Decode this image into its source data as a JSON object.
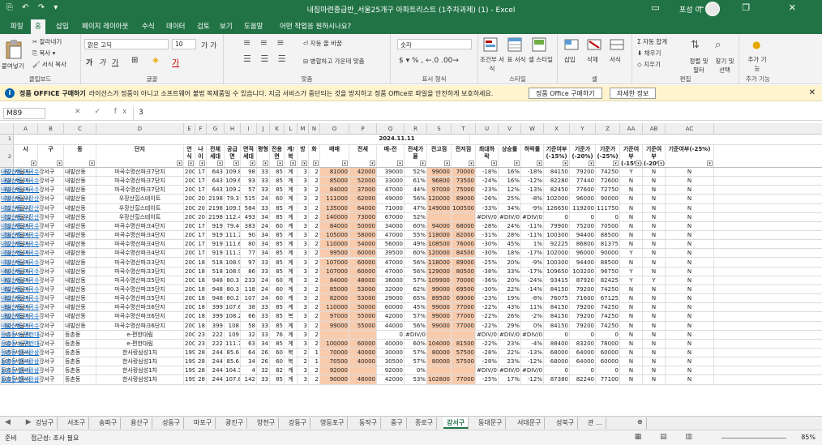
{
  "title": {
    "quick_access": "⎘ ↶ ↷ ▾",
    "doc": "내집마련종급반_서울25개구 아파트리스트 (1주차과제) (1) - Excel",
    "user": "포성 이",
    "avatar": "◯",
    "win": "▭ ─ ❐ ✕"
  },
  "tabs": [
    "파일",
    "홈",
    "삽입",
    "페이지 레이아웃",
    "수식",
    "데이터",
    "검토",
    "보기",
    "도움말",
    "어떤 작업을 원하시나요?"
  ],
  "ribbon": {
    "clipboard": {
      "paste": "붙여넣기",
      "cut": "잘라내기",
      "copy": "복사 ▾",
      "format": "서식 복사",
      "label": "클립보드"
    },
    "font": {
      "name": "맑은 고딕",
      "size": "10",
      "bold": "가",
      "italic": "가",
      "under": "가",
      "label": "글꼴",
      "grow": "가 가"
    },
    "align": {
      "wrap": "자동 줄 바꿈",
      "merge": "병합하고 가운데 맞춤",
      "label": "맞춤"
    },
    "number": {
      "format": "숫자",
      "pct": "% ,",
      "label": "표시 형식"
    },
    "styles": {
      "cond": "조건부 서식",
      "table": "표 서식",
      "cell": "셀 스타일",
      "label": "스타일"
    },
    "cells": {
      "insert": "삽입",
      "delete": "삭제",
      "format": "서식",
      "label": "셀"
    },
    "edit": {
      "sum": "자동 합계",
      "fill": "채우기",
      "clear": "지우기",
      "sort": "정렬 및 필터",
      "find": "찾기 및 선택",
      "label": "편집"
    },
    "addin": {
      "btn": "추가 기능",
      "label": "추가 기능"
    }
  },
  "message": {
    "bold": "정품 OFFICE 구매하기",
    "text": "라이선스가 정품이 아니고 소프트웨어 불법 복제품일 수 있습니다. 지금 서비스가 중단되는 것을 방지하고 정품 Office로 파일을 안전하게 보호하세요.",
    "btn1": "정품 Office 구매하기",
    "btn2": "자세한 정보",
    "close": "✕"
  },
  "formula": {
    "cell": "M89",
    "fx": "✕ ✓ fx",
    "value": "3"
  },
  "columns": [
    "A",
    "B",
    "C",
    "D",
    "E",
    "F",
    "G",
    "H",
    "I",
    "J",
    "K",
    "L",
    "M",
    "N",
    "O",
    "P",
    "Q",
    "R",
    "S",
    "T",
    "U",
    "V",
    "W",
    "X",
    "Y",
    "Z",
    "AA",
    "AB",
    "AC"
  ],
  "date": "2024.11.11",
  "headers": [
    "시",
    "구",
    "동",
    "단지",
    "연식",
    "나이",
    "전체세대",
    "공급면",
    "면적세대",
    "평형",
    "전용면",
    "계/복",
    "방",
    "화",
    "매매",
    "전세",
    "매-전",
    "전세가율",
    "전고점",
    "전저점",
    "최대하락",
    "상승률",
    "하락률",
    "기준여부(-15%)",
    "기준가(-20%)",
    "기준가(-25%)",
    "기준여부(-15%)",
    "기준여부(-20%)",
    "기준여부(-25%)"
  ],
  "rows": [
    {
      "n": "67",
      "d": [
        "서울시",
        "강서구",
        "내발산동",
        "마곡수명산파크7단지",
        "2008",
        "17",
        "643",
        "109.8",
        "98",
        "33",
        "85",
        "계",
        "3",
        "2",
        "81000",
        "42000",
        "39000",
        "52%",
        "99000",
        "70000",
        "-18%",
        "16%",
        "-18%",
        "84150",
        "79200",
        "74250",
        "Y",
        "N",
        "N",
        "내발산동 마곡수"
      ]
    },
    {
      "n": "68",
      "d": [
        "서울시",
        "강서구",
        "내발산동",
        "마곡수명산파크7단지",
        "2008",
        "17",
        "643",
        "109.6",
        "93",
        "33",
        "85",
        "계",
        "3",
        "2",
        "85000",
        "52000",
        "33000",
        "61%",
        "96800",
        "73500",
        "-24%",
        "16%",
        "-12%",
        "82280",
        "77440",
        "72600",
        "N",
        "N",
        "N",
        "내발산동 마곡수"
      ]
    },
    {
      "n": "69",
      "d": [
        "서울시",
        "강서구",
        "내발산동",
        "마곡수명산파크7단지",
        "2008",
        "17",
        "643",
        "109.2",
        "57",
        "33",
        "85",
        "계",
        "3",
        "2",
        "84000",
        "37000",
        "47000",
        "44%",
        "97000",
        "75000",
        "-23%",
        "12%",
        "-13%",
        "82450",
        "77600",
        "72750",
        "N",
        "N",
        "N",
        "내발산동 마곡수"
      ]
    },
    {
      "n": "70",
      "d": [
        "서울시",
        "강서구",
        "내발산동",
        "우장산힐스테이트",
        "2005",
        "20",
        "2198",
        "79.3",
        "515",
        "24",
        "60",
        "계",
        "3",
        "2",
        "111000",
        "62000",
        "49000",
        "56%",
        "120000",
        "89000",
        "-26%",
        "25%",
        "-8%",
        "102000",
        "96000",
        "90000",
        "N",
        "N",
        "N",
        "내발산동 우장산"
      ]
    },
    {
      "n": "71",
      "d": [
        "서울시",
        "강서구",
        "내발산동",
        "우장산힐스테이트",
        "2005",
        "20",
        "2198",
        "109.1",
        "584",
        "33",
        "85",
        "계",
        "3",
        "2",
        "135000",
        "64000",
        "71000",
        "47%",
        "149000",
        "100500",
        "-33%",
        "34%",
        "-9%",
        "126650",
        "119200",
        "111750",
        "N",
        "N",
        "N",
        "내발산동 우장산"
      ]
    },
    {
      "n": "72",
      "d": [
        "서울시",
        "강서구",
        "내발산동",
        "우장산힐스테이트",
        "2005",
        "20",
        "2198",
        "112.4",
        "493",
        "34",
        "85",
        "계",
        "3",
        "2",
        "140000",
        "73000",
        "67000",
        "52%",
        "",
        "",
        "#DIV/0!",
        "#DIV/0!",
        "#DIV/0!",
        "0",
        "0",
        "0",
        "N",
        "N",
        "N",
        "내발산동 우장산"
      ]
    },
    {
      "n": "75",
      "d": [
        "서울시",
        "강서구",
        "내발산동",
        "마곡수명산파크4단지",
        "2008",
        "17",
        "919",
        "79.4",
        "383",
        "24",
        "60",
        "계",
        "3",
        "2",
        "84000",
        "50000",
        "34000",
        "60%",
        "94000",
        "68000",
        "-28%",
        "24%",
        "-11%",
        "79900",
        "75200",
        "70500",
        "N",
        "N",
        "N",
        "내발산동 마곡수"
      ]
    },
    {
      "n": "76",
      "d": [
        "서울시",
        "강서구",
        "내발산동",
        "마곡수명산파크4단지",
        "2008",
        "17",
        "919",
        "111.7",
        "90",
        "34",
        "85",
        "계",
        "3",
        "2",
        "105000",
        "58000",
        "47000",
        "55%",
        "118000",
        "82000",
        "-31%",
        "28%",
        "-11%",
        "100300",
        "94400",
        "88500",
        "N",
        "N",
        "N",
        "내발산동 마곡수"
      ]
    },
    {
      "n": "77",
      "d": [
        "서울시",
        "강서구",
        "내발산동",
        "마곡수명산파크4단지",
        "2008",
        "17",
        "919",
        "111.6",
        "80",
        "34",
        "85",
        "계",
        "3",
        "2",
        "110000",
        "54000",
        "56000",
        "49%",
        "108500",
        "76000",
        "-30%",
        "45%",
        "1%",
        "92225",
        "86800",
        "81375",
        "N",
        "N",
        "N",
        "내발산동 마곡수"
      ]
    },
    {
      "n": "78",
      "d": [
        "서울시",
        "강서구",
        "내발산동",
        "마곡수명산파크4단지",
        "2008",
        "17",
        "919",
        "111.3",
        "77",
        "34",
        "85",
        "계",
        "3",
        "2",
        "99500",
        "60000",
        "39500",
        "60%",
        "120000",
        "84500",
        "-30%",
        "18%",
        "-17%",
        "102000",
        "96000",
        "90000",
        "Y",
        "N",
        "N",
        "내발산동 마곡수"
      ]
    },
    {
      "n": "79",
      "d": [
        "서울시",
        "강서구",
        "내발산동",
        "마곡수명산파크3단지",
        "2007",
        "18",
        "518",
        "108.9",
        "97",
        "33",
        "85",
        "계",
        "3",
        "2",
        "107000",
        "60000",
        "47000",
        "56%",
        "118000",
        "89000",
        "-25%",
        "20%",
        "-9%",
        "100300",
        "94400",
        "88500",
        "N",
        "N",
        "N",
        "내발산동 마곡수"
      ]
    },
    {
      "n": "80",
      "d": [
        "서울시",
        "강서구",
        "내발산동",
        "마곡수명산파크3단지",
        "2007",
        "18",
        "518",
        "108.9",
        "86",
        "33",
        "85",
        "계",
        "3",
        "2",
        "107000",
        "60000",
        "47000",
        "56%",
        "129000",
        "80500",
        "-38%",
        "33%",
        "-17%",
        "109650",
        "103200",
        "96750",
        "Y",
        "N",
        "N",
        "내발산동 마곡수"
      ]
    },
    {
      "n": "81",
      "d": [
        "서울시",
        "강서구",
        "내발산동",
        "마곡수명산파크5단지",
        "2007",
        "18",
        "948",
        "80.3",
        "233",
        "24",
        "60",
        "계",
        "3",
        "2",
        "84000",
        "48000",
        "36000",
        "57%",
        "109900",
        "70000",
        "-36%",
        "20%",
        "-24%",
        "93415",
        "87920",
        "82425",
        "Y",
        "Y",
        "N",
        "내발산동 마곡수"
      ]
    },
    {
      "n": "82",
      "d": [
        "서울시",
        "강서구",
        "내발산동",
        "마곡수명산파크5단지",
        "2007",
        "18",
        "948",
        "80.3",
        "118",
        "24",
        "60",
        "계",
        "3",
        "2",
        "85000",
        "53000",
        "32000",
        "62%",
        "99000",
        "69500",
        "-30%",
        "22%",
        "-14%",
        "84150",
        "79200",
        "74250",
        "N",
        "N",
        "N",
        "내발산동 마곡수"
      ]
    },
    {
      "n": "83",
      "d": [
        "서울시",
        "강서구",
        "내발산동",
        "마곡수명산파크5단지",
        "2007",
        "18",
        "948",
        "80.2",
        "107",
        "24",
        "60",
        "계",
        "3",
        "2",
        "82000",
        "53000",
        "29000",
        "65%",
        "89500",
        "69000",
        "-23%",
        "19%",
        "-8%",
        "76075",
        "71600",
        "67125",
        "N",
        "N",
        "N",
        "내발산동 마곡수"
      ]
    },
    {
      "n": "84",
      "d": [
        "서울시",
        "강서구",
        "내발산동",
        "마곡수명산파크6단지",
        "2007",
        "18",
        "399",
        "107.6",
        "38",
        "33",
        "85",
        "계",
        "3",
        "2",
        "110000",
        "50000",
        "60000",
        "45%",
        "99000",
        "77000",
        "-22%",
        "43%",
        "11%",
        "84150",
        "79200",
        "74250",
        "N",
        "N",
        "N",
        "내발산동 마곡수"
      ]
    },
    {
      "n": "89",
      "d": [
        "서울시",
        "강서구",
        "내발산동",
        "마곡수명산파크6단지",
        "2007",
        "18",
        "399",
        "108.2",
        "66",
        "33",
        "85",
        "복",
        "3",
        "2",
        "97000",
        "55000",
        "42000",
        "57%",
        "99000",
        "77000",
        "-22%",
        "26%",
        "-2%",
        "84150",
        "79200",
        "74250",
        "N",
        "N",
        "N",
        "내발산동 마곡수"
      ]
    },
    {
      "n": "90",
      "d": [
        "서울시",
        "강서구",
        "내발산동",
        "마곡수명산파크6단지",
        "2007",
        "18",
        "399",
        "108",
        "58",
        "33",
        "85",
        "계",
        "3",
        "2",
        "99000",
        "55000",
        "44000",
        "56%",
        "99000",
        "77000",
        "-22%",
        "29%",
        "0%",
        "84150",
        "79200",
        "74250",
        "N",
        "N",
        "N",
        "내발산동 마곡수"
      ]
    },
    {
      "n": "91",
      "d": [
        "서울시",
        "강서구",
        "등촌동",
        "e-편한대림",
        "2002",
        "23",
        "222",
        "109",
        "32",
        "33",
        "76",
        "계",
        "3",
        "2",
        "",
        "",
        "0",
        "#DIV/0!",
        "",
        "",
        "#DIV/0!",
        "#DIV/0!",
        "#DIV/0!",
        "0",
        "0",
        "0",
        "N",
        "N",
        "N",
        "등촌동 e-편한대"
      ]
    },
    {
      "n": "92",
      "d": [
        "서울시",
        "강서구",
        "등촌동",
        "e-편한대림",
        "2002",
        "23",
        "222",
        "111.7",
        "63",
        "34",
        "85",
        "계",
        "3",
        "2",
        "100000",
        "60000",
        "40000",
        "60%",
        "104000",
        "81500",
        "-22%",
        "23%",
        "-4%",
        "88400",
        "83200",
        "78000",
        "N",
        "N",
        "N",
        "등촌동 e-편한대"
      ]
    },
    {
      "n": "99",
      "d": [
        "서울시",
        "강서구",
        "등촌동",
        "한사랑삼성1차",
        "1997",
        "28",
        "244",
        "85.6",
        "64",
        "26",
        "60",
        "복",
        "2",
        "1",
        "70000",
        "40000",
        "30000",
        "57%",
        "80000",
        "57500",
        "-28%",
        "22%",
        "-13%",
        "68000",
        "64000",
        "60000",
        "N",
        "N",
        "N",
        "등촌동 한사랑삼"
      ]
    },
    {
      "n": "100",
      "d": [
        "서울시",
        "강서구",
        "등촌동",
        "한사랑삼성1차",
        "1997",
        "28",
        "244",
        "85.6",
        "34",
        "26",
        "60",
        "복",
        "2",
        "1",
        "70500",
        "40000",
        "30500",
        "57%",
        "80000",
        "57500",
        "-28%",
        "23%",
        "-12%",
        "68000",
        "64000",
        "60000",
        "N",
        "N",
        "N",
        "등촌동 한사랑삼"
      ]
    },
    {
      "n": "101",
      "d": [
        "서울시",
        "강서구",
        "등촌동",
        "한사랑삼성1차",
        "1997",
        "28",
        "244",
        "104.3",
        "4",
        "32",
        "82",
        "계",
        "3",
        "2",
        "92000",
        "",
        "92000",
        "0%",
        "",
        "",
        "#DIV/0!",
        "#DIV/0!",
        "#DIV/0!",
        "0",
        "0",
        "0",
        "N",
        "N",
        "N",
        "등촌동 한사랑삼"
      ]
    },
    {
      "n": "102",
      "d": [
        "서울시",
        "강서구",
        "등촌동",
        "한사랑삼성1차",
        "1997",
        "28",
        "244",
        "107.8",
        "142",
        "33",
        "85",
        "계",
        "3",
        "2",
        "90000",
        "48000",
        "42000",
        "53%",
        "102800",
        "77000",
        "-25%",
        "17%",
        "-12%",
        "87380",
        "82240",
        "77100",
        "N",
        "N",
        "N",
        "등촌동 한사랑삼"
      ]
    }
  ],
  "sheets": [
    "강남구",
    "서초구",
    "송파구",
    "용산구",
    "성동구",
    "마포구",
    "광진구",
    "양천구",
    "강동구",
    "영등포구",
    "동작구",
    "중구",
    "종로구",
    "강서구",
    "동대문구",
    "서대문구",
    "성북구",
    "관 ..."
  ],
  "active_sheet": "강서구",
  "status": {
    "ready": "준비",
    "access": "접근성: 조사 필요",
    "zoom": "85%"
  }
}
